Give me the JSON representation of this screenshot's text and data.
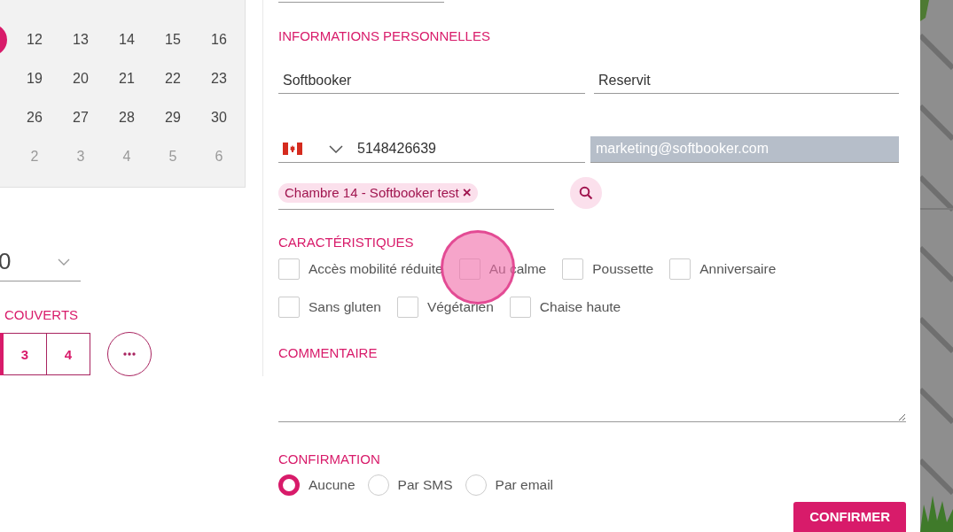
{
  "calendar": {
    "rows": [
      {
        "leading_selected": true,
        "days": [
          {
            "label": "12",
            "muted": false
          },
          {
            "label": "13",
            "muted": false
          },
          {
            "label": "14",
            "muted": false
          },
          {
            "label": "15",
            "muted": false
          },
          {
            "label": "16",
            "muted": false
          }
        ]
      },
      {
        "days": [
          {
            "label": "19",
            "muted": false
          },
          {
            "label": "20",
            "muted": false
          },
          {
            "label": "21",
            "muted": false
          },
          {
            "label": "22",
            "muted": false
          },
          {
            "label": "23",
            "muted": false
          }
        ]
      },
      {
        "days": [
          {
            "label": "26",
            "muted": false
          },
          {
            "label": "27",
            "muted": false
          },
          {
            "label": "28",
            "muted": false
          },
          {
            "label": "29",
            "muted": false
          },
          {
            "label": "30",
            "muted": false
          }
        ]
      },
      {
        "days": [
          {
            "label": "2",
            "muted": true
          },
          {
            "label": "3",
            "muted": true
          },
          {
            "label": "4",
            "muted": true
          },
          {
            "label": "5",
            "muted": true
          },
          {
            "label": "6",
            "muted": true
          }
        ]
      }
    ]
  },
  "time_select": {
    "value": "0"
  },
  "covers": {
    "title": "COUVERTS",
    "leading_selected": true,
    "options": [
      {
        "label": "3",
        "selected": false
      },
      {
        "label": "4",
        "selected": false
      }
    ]
  },
  "personal": {
    "title": "INFORMATIONS PERSONNELLES",
    "first_name": "Softbooker",
    "last_name": "Reservit",
    "phone": "5148426639",
    "email": {
      "value": "marketing@softbooker.com",
      "disabled": true
    },
    "room_chip": "Chambre 14 - Softbooker test",
    "chip_remove": "×"
  },
  "features": {
    "title": "CARACTÉRISTIQUES",
    "rows": [
      [
        {
          "label": "Accès mobilité réduite",
          "checked": false
        },
        {
          "label": "Au calme",
          "checked": false
        },
        {
          "label": "Poussette",
          "checked": false
        },
        {
          "label": "Anniversaire",
          "checked": false
        }
      ],
      [
        {
          "label": "Sans gluten",
          "checked": false
        },
        {
          "label": "Végétarien",
          "checked": false
        },
        {
          "label": "Chaise haute",
          "checked": false
        }
      ]
    ]
  },
  "tap_indicator": true,
  "comment": {
    "title": "COMMENTAIRE"
  },
  "confirmation": {
    "title": "CONFIRMATION",
    "options": [
      {
        "label": "Aucune",
        "selected": true
      },
      {
        "label": "Par SMS",
        "selected": false
      },
      {
        "label": "Par email",
        "selected": false
      }
    ]
  },
  "confirm_button": "CONFIRMER"
}
